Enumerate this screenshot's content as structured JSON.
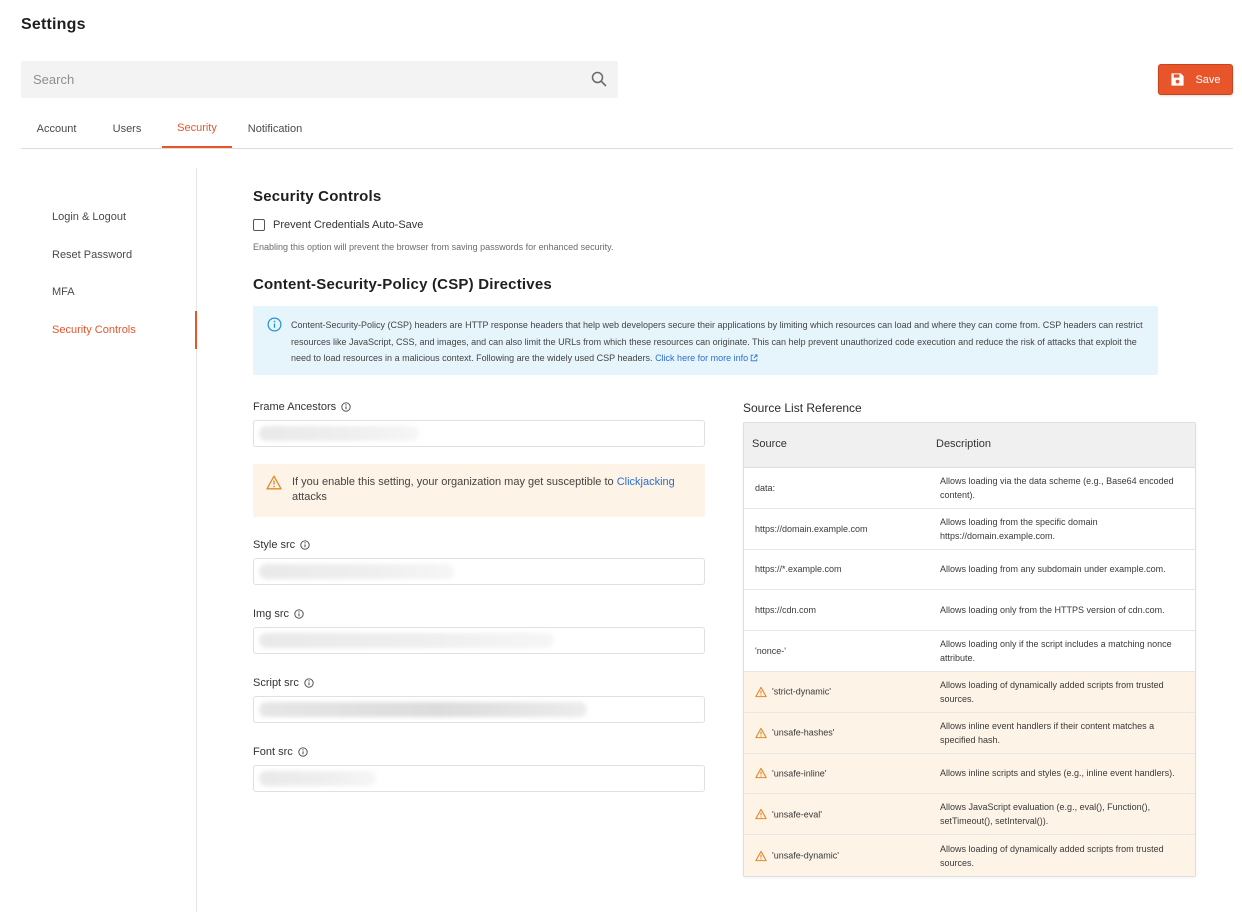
{
  "page": {
    "title": "Settings"
  },
  "search": {
    "placeholder": "Search"
  },
  "toolbar": {
    "save_label": "Save"
  },
  "colors": {
    "accent": "#e8552b",
    "info_bg": "#e6f4fb",
    "warn_bg": "#fdf3e6",
    "link": "#2a6fd6"
  },
  "tabs": [
    {
      "label": "Account"
    },
    {
      "label": "Users"
    },
    {
      "label": "Security",
      "active": true
    },
    {
      "label": "Notification"
    }
  ],
  "sidebar": {
    "items": [
      {
        "label": "Login & Logout"
      },
      {
        "label": "Reset Password"
      },
      {
        "label": "MFA"
      },
      {
        "label": "Security Controls",
        "active": true
      }
    ]
  },
  "security_controls": {
    "heading": "Security Controls",
    "checkbox_label": "Prevent Credentials Auto-Save",
    "checkbox_checked": false,
    "helper": "Enabling this option will prevent the browser from saving passwords for enhanced security."
  },
  "csp": {
    "heading": "Content-Security-Policy (CSP) Directives",
    "info_text": "Content-Security-Policy (CSP) headers are HTTP response headers that help web developers secure their applications by limiting which resources can load and where they can come from. CSP headers can restrict resources like JavaScript, CSS, and images, and can also limit the URLs from which these resources can originate. This can help prevent unauthorized code execution and reduce the risk of attacks that exploit the need to load resources in a malicious context. Following are the widely used CSP headers.",
    "info_link": "Click here for more info"
  },
  "fields": {
    "frame_ancestors": {
      "label": "Frame Ancestors"
    },
    "style_src": {
      "label": "Style src"
    },
    "img_src": {
      "label": "Img src"
    },
    "script_src": {
      "label": "Script src"
    },
    "font_src": {
      "label": "Font src"
    }
  },
  "warning": {
    "text_before": "If you enable this setting, your organization may get susceptible to ",
    "link": "Clickjacking",
    "text_after": "attacks"
  },
  "reference": {
    "title": "Source List Reference",
    "columns": {
      "source": "Source",
      "description": "Description"
    },
    "rows": [
      {
        "source": "data:",
        "description": "Allows loading via the data scheme (e.g., Base64 encoded content).",
        "warn": false
      },
      {
        "source": "https://domain.example.com",
        "description": "Allows loading from the specific domain https://domain.example.com.",
        "warn": false
      },
      {
        "source": "https://*.example.com",
        "description": "Allows loading from any subdomain under example.com.",
        "warn": false
      },
      {
        "source": "https://cdn.com",
        "description": "Allows loading only from the HTTPS version of cdn.com.",
        "warn": false
      },
      {
        "source": "'nonce-'",
        "description": "Allows loading only if the script includes a matching nonce attribute.",
        "warn": false
      },
      {
        "source": "'strict-dynamic'",
        "description": "Allows loading of dynamically added scripts from trusted sources.",
        "warn": true
      },
      {
        "source": "'unsafe-hashes'",
        "description": "Allows inline event handlers if their content matches a specified hash.",
        "warn": true
      },
      {
        "source": "'unsafe-inline'",
        "description": "Allows inline scripts and styles (e.g., inline event handlers).",
        "warn": true
      },
      {
        "source": "'unsafe-eval'",
        "description": "Allows JavaScript evaluation (e.g., eval(), Function(), setTimeout(), setInterval()).",
        "warn": true
      },
      {
        "source": "'unsafe-dynamic'",
        "description": "Allows loading of dynamically added scripts from trusted sources.",
        "warn": true
      }
    ]
  }
}
